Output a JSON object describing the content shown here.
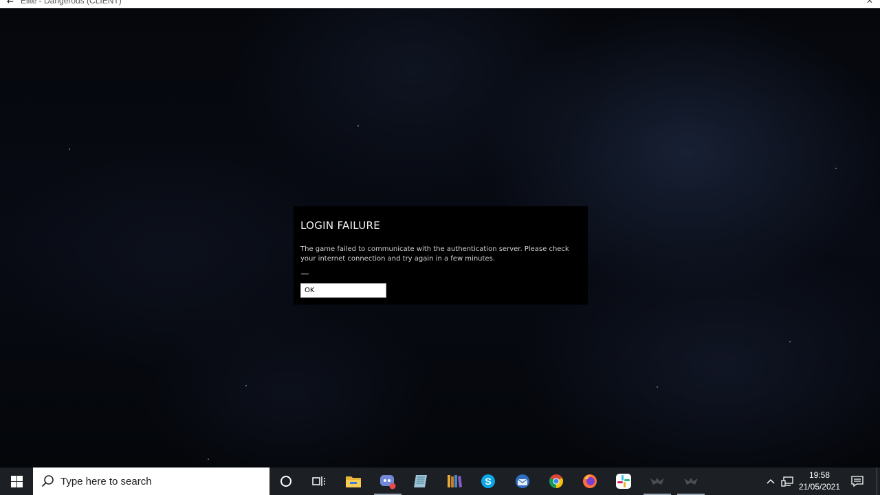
{
  "window": {
    "title": "Elite - Dangerous (CLIENT)",
    "back_glyph": "←",
    "close_glyph": "✕"
  },
  "dialog": {
    "title": "LOGIN FAILURE",
    "message": "The game failed to communicate with the authentication server. Please check your internet connection and try again in a few minutes.",
    "ok_label": "OK"
  },
  "taskbar": {
    "search_placeholder": "Type here to search",
    "pinned": [
      {
        "name": "cortana-icon"
      },
      {
        "name": "task-view-icon"
      },
      {
        "name": "file-explorer-icon"
      },
      {
        "name": "discord-icon"
      },
      {
        "name": "notepad-icon"
      },
      {
        "name": "library-icon"
      },
      {
        "name": "skype-icon"
      },
      {
        "name": "thunderbird-icon"
      },
      {
        "name": "chrome-icon"
      },
      {
        "name": "firefox-icon"
      },
      {
        "name": "slack-icon"
      },
      {
        "name": "elite-launcher-icon"
      },
      {
        "name": "elite-client-icon"
      }
    ],
    "clock": {
      "time": "19:58",
      "date": "21/05/2021"
    }
  },
  "colors": {
    "dialog_bg": "#000000",
    "taskbar_bg": "#1c2024",
    "ok_button_bg": "#ffffff"
  }
}
